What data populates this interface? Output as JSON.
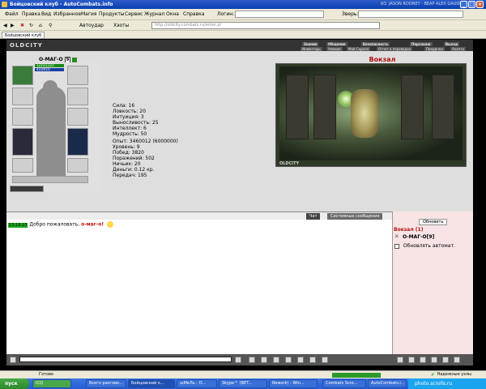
{
  "window": {
    "title": "Бойцовский клуб - AutoCombats.info",
    "right_text": "ИЗ. JASON ROONEY · ВЕАР ALEX GAUDINO AND JASO"
  },
  "menu": [
    "Файл",
    "Правка",
    "Вид",
    "Избранное",
    "Магия",
    "Продукты",
    "Сервис",
    "Журнал",
    "Окна",
    "Справка"
  ],
  "toolbar": {
    "login_label": "Логин:",
    "server_label": "Зверь:",
    "autostart": "Автоудар",
    "favorites": "Хэоты",
    "address": "http://oldcity.combats.ru/enter.pl"
  },
  "tab": {
    "label": "Бойцовский клуб"
  },
  "game": {
    "logo": "OLDCITY",
    "nav_top": [
      "Знания",
      "Общение",
      "Безопасность",
      "Персонаж",
      "Выход"
    ],
    "nav_bottom": [
      "Инвентарь",
      "Умения",
      "Мой Скролл",
      "Отчет о переводах",
      "Поединки",
      "Анкета"
    ],
    "character": {
      "nick": "О-МАГ-О",
      "level": "9",
      "hp": "1221/1221",
      "mp": "410/410"
    },
    "stats": [
      {
        "label": "Сила: 16"
      },
      {
        "label": "Ловкость: 20"
      },
      {
        "label": "Интуиция: 3"
      },
      {
        "label": "Выносливость: 25"
      },
      {
        "label": "Интеллект: 6"
      },
      {
        "label": "Мудрость: 50"
      }
    ],
    "stats2": [
      {
        "label": "Опыт: 3460012 (6000000)"
      },
      {
        "label": "Уровень: 9"
      },
      {
        "label": "Побед: 3820"
      },
      {
        "label": "Поражений: 502"
      },
      {
        "label": "Ничьих: 20"
      },
      {
        "label": "Деньги: 0.12 кр."
      },
      {
        "label": "Передач: 195"
      }
    ],
    "location": {
      "title": "Вокзал",
      "scene_label": "OLDCITY"
    }
  },
  "chat": {
    "tab_chat": "Чат",
    "tab_system": "Системные сообщения",
    "message": {
      "time": "13:18:23",
      "text": "Добро пожаловать,",
      "who": "о-маг-о!"
    }
  },
  "sidebar": {
    "refresh": "Обновить",
    "room": "Вокзал (1)",
    "player": "О-МАГ-О[9]",
    "auto_refresh": "Обновлять автомат."
  },
  "status": {
    "text": "Готово",
    "secure": "Надежные узлы"
  },
  "taskbar": {
    "start": "пуск",
    "items": [
      "ICQ",
      "Всего разгово...",
      "Бойцовский к...",
      "шМеЛь - О...",
      "Skype™ (BET...",
      "Rework) - Win...",
      "Combats Scro...",
      "AutoCombats.i..."
    ],
    "tray": "photo.scrolls.ru"
  },
  "colors": {
    "hp": "#1a8a1a",
    "mp": "#1a3fa0",
    "location_title": "#b01010",
    "chat_nick": "#c01010"
  }
}
